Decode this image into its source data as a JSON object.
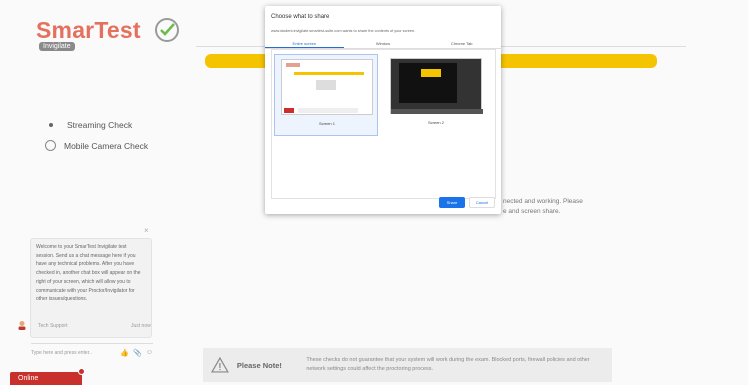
{
  "logo": {
    "brand": "SmarTest",
    "tag": "Invigilate"
  },
  "progress": {
    "text": ""
  },
  "checks": [
    {
      "label": "Streaming Check",
      "state": "current"
    },
    {
      "label": "Mobile Camera Check",
      "state": "pending"
    }
  ],
  "right_message": {
    "line1": "nected and working. Please",
    "line2": "e and screen share."
  },
  "chat": {
    "close_glyph": "×",
    "message": "Welcome to your SmarTest Invigilate test session. Send us a chat message here if you have any technical problems. After you have checked in, another chat box will appear on the right of your screen, which will allow you to communicate with your Proctor/Invigilator for other issues/questions.",
    "sender": "Tech Support",
    "time": "Just now",
    "input_placeholder": "Type here and press enter.."
  },
  "online_tab": {
    "label": "Online"
  },
  "note": {
    "title": "Please Note!",
    "body": "These checks do not guarantee that your system will work during the exam. Blocked ports, firewall policies and other network settings could affect the proctoring process."
  },
  "share_dialog": {
    "title": "Choose what to share",
    "subtitle": "www.student.invigilate.smartest-suite.com wants to share the contents of your screen.",
    "tabs": [
      "Entire screen",
      "Window",
      "Chrome Tab"
    ],
    "active_tab": 0,
    "screens": [
      {
        "label": "Screen 1",
        "selected": true
      },
      {
        "label": "Screen 2",
        "selected": false
      }
    ],
    "share_label": "Share",
    "cancel_label": "Cancel"
  },
  "colors": {
    "brand": "#e4705e",
    "progress_yellow": "#f5c400",
    "online_red": "#c9302c",
    "share_blue": "#1a73e8"
  }
}
